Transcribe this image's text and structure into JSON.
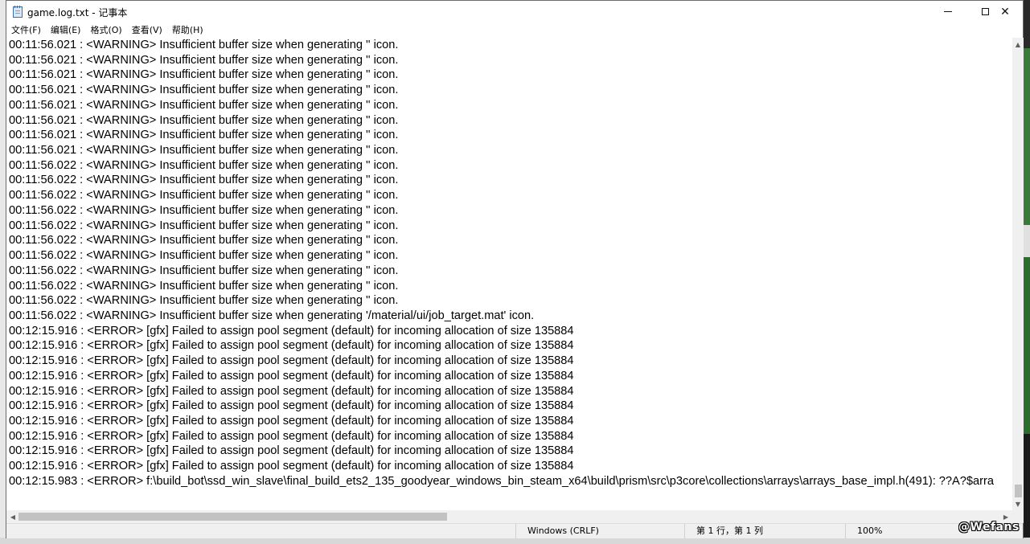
{
  "window": {
    "title": "game.log.txt - 记事本",
    "minimize_glyph": "",
    "maximize_glyph": "",
    "close_glyph": "✕"
  },
  "menu": [
    {
      "label": "文件(F)"
    },
    {
      "label": "编辑(E)"
    },
    {
      "label": "格式(O)"
    },
    {
      "label": "查看(V)"
    },
    {
      "label": "帮助(H)"
    }
  ],
  "editor": {
    "lines": [
      "00:11:56.021 : <WARNING> Insufficient buffer size when generating '' icon.",
      "00:11:56.021 : <WARNING> Insufficient buffer size when generating '' icon.",
      "00:11:56.021 : <WARNING> Insufficient buffer size when generating '' icon.",
      "00:11:56.021 : <WARNING> Insufficient buffer size when generating '' icon.",
      "00:11:56.021 : <WARNING> Insufficient buffer size when generating '' icon.",
      "00:11:56.021 : <WARNING> Insufficient buffer size when generating '' icon.",
      "00:11:56.021 : <WARNING> Insufficient buffer size when generating '' icon.",
      "00:11:56.021 : <WARNING> Insufficient buffer size when generating '' icon.",
      "00:11:56.022 : <WARNING> Insufficient buffer size when generating '' icon.",
      "00:11:56.022 : <WARNING> Insufficient buffer size when generating '' icon.",
      "00:11:56.022 : <WARNING> Insufficient buffer size when generating '' icon.",
      "00:11:56.022 : <WARNING> Insufficient buffer size when generating '' icon.",
      "00:11:56.022 : <WARNING> Insufficient buffer size when generating '' icon.",
      "00:11:56.022 : <WARNING> Insufficient buffer size when generating '' icon.",
      "00:11:56.022 : <WARNING> Insufficient buffer size when generating '' icon.",
      "00:11:56.022 : <WARNING> Insufficient buffer size when generating '' icon.",
      "00:11:56.022 : <WARNING> Insufficient buffer size when generating '' icon.",
      "00:11:56.022 : <WARNING> Insufficient buffer size when generating '' icon.",
      "00:11:56.022 : <WARNING> Insufficient buffer size when generating '/material/ui/job_target.mat' icon.",
      "00:12:15.916 : <ERROR> [gfx] Failed to assign pool segment (default) for incoming allocation of size 135884",
      "00:12:15.916 : <ERROR> [gfx] Failed to assign pool segment (default) for incoming allocation of size 135884",
      "00:12:15.916 : <ERROR> [gfx] Failed to assign pool segment (default) for incoming allocation of size 135884",
      "00:12:15.916 : <ERROR> [gfx] Failed to assign pool segment (default) for incoming allocation of size 135884",
      "00:12:15.916 : <ERROR> [gfx] Failed to assign pool segment (default) for incoming allocation of size 135884",
      "00:12:15.916 : <ERROR> [gfx] Failed to assign pool segment (default) for incoming allocation of size 135884",
      "00:12:15.916 : <ERROR> [gfx] Failed to assign pool segment (default) for incoming allocation of size 135884",
      "00:12:15.916 : <ERROR> [gfx] Failed to assign pool segment (default) for incoming allocation of size 135884",
      "00:12:15.916 : <ERROR> [gfx] Failed to assign pool segment (default) for incoming allocation of size 135884",
      "00:12:15.916 : <ERROR> [gfx] Failed to assign pool segment (default) for incoming allocation of size 135884",
      "00:12:15.983 : <ERROR> f:\\build_bot\\ssd_win_slave\\final_build_ets2_135_goodyear_windows_bin_steam_x64\\build\\prism\\src\\p3core\\collections\\arrays\\arrays_base_impl.h(491): ??A?$arra"
    ]
  },
  "scrollbars": {
    "up_arrow": "▲",
    "down_arrow": "▼",
    "left_arrow": "◀",
    "right_arrow": "▶"
  },
  "status": {
    "encoding": "Windows (CRLF)",
    "position": "第 1 行，第 1 列",
    "zoom": "100%"
  },
  "watermark": "@Wefans"
}
